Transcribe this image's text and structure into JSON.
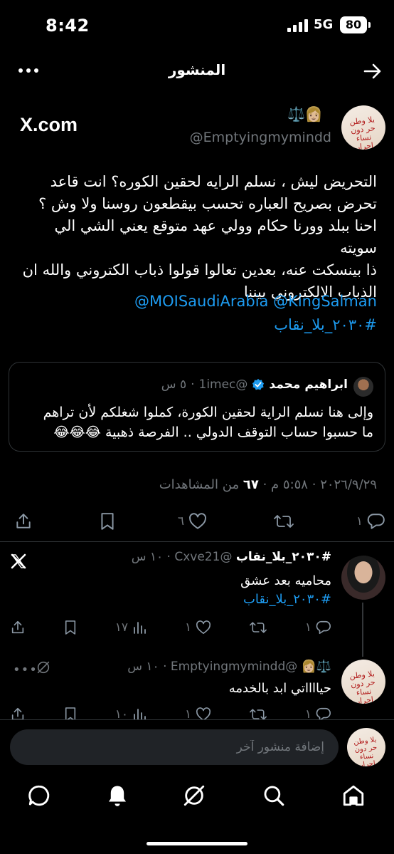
{
  "status_bar": {
    "time": "8:42",
    "network": "5G",
    "battery": "80"
  },
  "header": {
    "title": "المنشور"
  },
  "main_post": {
    "source_label": "X.com",
    "avatar_scrawl": "بلا وطن حر دون نساء احرار",
    "name_emoji": "⚖️👩🏼",
    "handle": "@Emptyingmymindd",
    "text_lines": [
      "التحريض ليش ، نسلم الرايه لحقين الكوره؟ انت قاعد",
      "تحرض بصريح العباره تحسب بيقطعون روسنا ولا وش ؟",
      "احنا ببلد وورنا حكام وولي عهد متوقع يعني الشي الي سويته",
      "ذا بينسكت عنه، بعدين تعالوا قولوا ذباب الكتروني والله ان",
      "الذباب الالكتروني بيننا"
    ],
    "mentions": "@MOISaudiArabia @KingSalman",
    "hashtag": "#٢٠٣٠_بلا_نقاب",
    "quoted": {
      "name": "ابراهيم محمد",
      "handle": "@1imec",
      "time": "٥ س",
      "text_lines": [
        "وإلى هنا نسلم الراية لحقين الكورة، كملوا شغلكم لأن تراهم",
        "ما حسبوا حساب التوقف الدولي .. الفرصة ذهبية 😂😂😂"
      ]
    },
    "date": "٢٠٢٦/٩/٢٩",
    "clock": "٥:٥٨ م",
    "views_count": "٦٧",
    "views_label": "من المشاهدات",
    "stats": {
      "replies": "١",
      "reposts": "",
      "likes": "٦",
      "bookmarks": "",
      "share": ""
    }
  },
  "replies": [
    {
      "name": "#٢٠٣٠_بلا_نقاب",
      "handle": "@Cxve21",
      "time": "١٠ س",
      "text": "محاميه بعد عشق",
      "hashtag": "#٢٠٣٠_بلا_نقاب",
      "stats": {
        "replies": "١",
        "reposts": "",
        "likes": "١",
        "views": "١٧"
      }
    },
    {
      "name_emoji": "⚖️👩🏼",
      "handle": "@Emptyingmymindd",
      "time": "١٠ س",
      "text": "حيااااتي ابد بالخدمه",
      "stats": {
        "replies": "١",
        "reposts": "",
        "likes": "١",
        "views": "١٠"
      }
    }
  ],
  "compose": {
    "placeholder": "إضافة منشور آخر"
  },
  "nav": [
    "home-icon",
    "search-icon",
    "grok-icon",
    "notifications-icon",
    "messages-icon"
  ]
}
